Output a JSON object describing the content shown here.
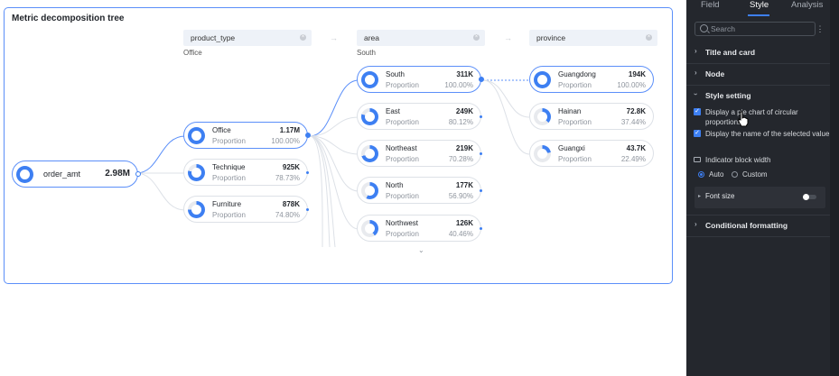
{
  "canvas": {
    "title": "Metric decomposition tree",
    "headers": [
      {
        "label": "product_type",
        "selected": "Office"
      },
      {
        "label": "area",
        "selected": "South"
      },
      {
        "label": "province",
        "selected": ""
      }
    ],
    "root": {
      "name": "order_amt",
      "value": "2.98M"
    },
    "nodes": [
      {
        "name": "Office",
        "value": "1.17M",
        "label": "Proportion",
        "pct": "100.00%"
      },
      {
        "name": "Technique",
        "value": "925K",
        "label": "Proportion",
        "pct": "78.73%"
      },
      {
        "name": "Furniture",
        "value": "878K",
        "label": "Proportion",
        "pct": "74.80%"
      },
      {
        "name": "South",
        "value": "311K",
        "label": "Proportion",
        "pct": "100.00%"
      },
      {
        "name": "East",
        "value": "249K",
        "label": "Proportion",
        "pct": "80.12%"
      },
      {
        "name": "Northeast",
        "value": "219K",
        "label": "Proportion",
        "pct": "70.28%"
      },
      {
        "name": "North",
        "value": "177K",
        "label": "Proportion",
        "pct": "56.90%"
      },
      {
        "name": "Northwest",
        "value": "126K",
        "label": "Proportion",
        "pct": "40.46%"
      },
      {
        "name": "Guangdong",
        "value": "194K",
        "label": "Proportion",
        "pct": "100.00%"
      },
      {
        "name": "Hainan",
        "value": "72.8K",
        "label": "Proportion",
        "pct": "37.44%"
      },
      {
        "name": "Guangxi",
        "value": "43.7K",
        "label": "Proportion",
        "pct": "22.49%"
      }
    ],
    "ring_colors": {
      "fill": "#3d7ff2",
      "track": "#e8eaee"
    }
  },
  "panel": {
    "tabs": [
      "Field",
      "Style",
      "Analysis"
    ],
    "active_tab": "Style",
    "search_placeholder": "Search",
    "sections": {
      "title_card": "Title and card",
      "node": "Node",
      "style_setting": "Style setting",
      "conditional": "Conditional formatting"
    },
    "options": [
      {
        "label": "Display a pie chart of circular proportions",
        "checked": true
      },
      {
        "label": "Display the name of the selected value",
        "checked": true
      }
    ],
    "indicator_label": "Indicator block width",
    "radio": [
      {
        "label": "Auto",
        "selected": true
      },
      {
        "label": "Custom",
        "selected": false
      }
    ],
    "font_size": {
      "label": "Font size",
      "enabled": false
    }
  },
  "colors": {
    "accent": "#3d7ff2",
    "panel_bg": "#24272d",
    "card_border": "#5b8ff9"
  }
}
